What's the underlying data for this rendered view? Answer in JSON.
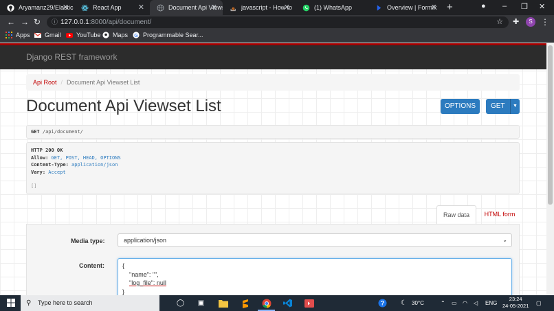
{
  "browser": {
    "tabs": [
      {
        "title": "Aryamanz29/Elastic",
        "icon": "github-icon"
      },
      {
        "title": "React App",
        "icon": "react-icon"
      },
      {
        "title": "Document Api Viewset",
        "icon": "globe-icon",
        "active": true
      },
      {
        "title": "javascript - How to",
        "icon": "stackoverflow-icon"
      },
      {
        "title": "(1) WhatsApp",
        "icon": "whatsapp-icon"
      },
      {
        "title": "Overview | Formik",
        "icon": "formik-icon"
      }
    ],
    "url_host": "127.0.0.1",
    "url_path": ":8000/api/document/",
    "profile_initial": "S",
    "bookmarks": [
      {
        "label": "Apps",
        "icon": "apps-grid-icon"
      },
      {
        "label": "Gmail",
        "icon": "gmail-icon"
      },
      {
        "label": "YouTube",
        "icon": "youtube-icon"
      },
      {
        "label": "Maps",
        "icon": "maps-icon"
      },
      {
        "label": "Programmable Sear...",
        "icon": "google-icon"
      }
    ]
  },
  "page": {
    "brand": "Django REST framework",
    "breadcrumb": {
      "root": "Api Root",
      "current": "Document Api Viewset List"
    },
    "title": "Document Api Viewset List",
    "buttons": {
      "options": "OPTIONS",
      "get": "GET"
    },
    "request": {
      "method": "GET",
      "path": "/api/document/"
    },
    "response": {
      "status": "HTTP 200 OK",
      "headers": [
        {
          "key": "Allow:",
          "value": "GET, POST, HEAD, OPTIONS"
        },
        {
          "key": "Content-Type:",
          "value": "application/json"
        },
        {
          "key": "Vary:",
          "value": "Accept"
        }
      ],
      "body": "[]"
    },
    "form_tabs": {
      "raw": "Raw data",
      "html": "HTML form"
    },
    "form": {
      "media_label": "Media type:",
      "media_value": "application/json",
      "content_label": "Content:",
      "content_lines": [
        "{",
        "\"name\": \"\",",
        "\"log_file\": null",
        "}"
      ]
    }
  },
  "taskbar": {
    "search_placeholder": "Type here to search",
    "weather": "30°C",
    "language": "ENG",
    "time": "23:24",
    "date": "24-05-2021"
  },
  "colors": {
    "drf_red": "#a30000",
    "link_red": "#c20000",
    "button_blue": "#2c7bbf"
  }
}
